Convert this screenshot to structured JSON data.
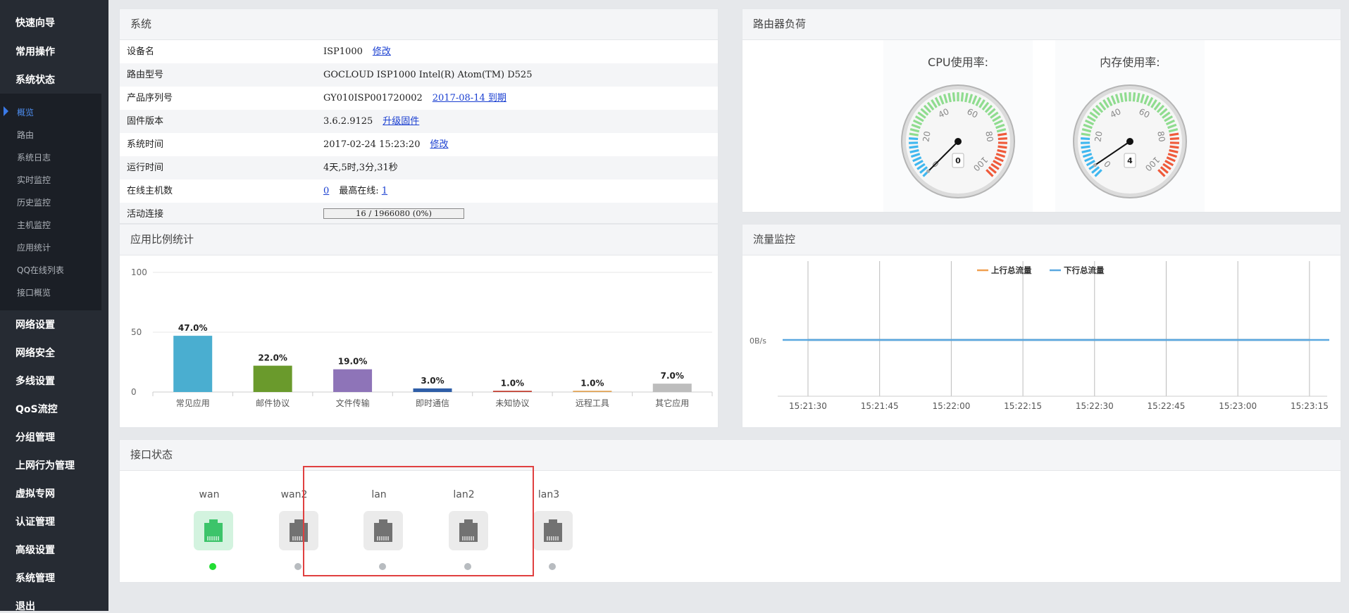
{
  "sidebar": {
    "menu": [
      "快速向导",
      "常用操作",
      "系统状态",
      "网络设置",
      "网络安全",
      "多线设置",
      "QoS流控",
      "分组管理",
      "上网行为管理",
      "虚拟专网",
      "认证管理",
      "高级设置",
      "系统管理",
      "退出"
    ],
    "submenu": [
      "概览",
      "路由",
      "系统日志",
      "实时监控",
      "历史监控",
      "主机监控",
      "应用统计",
      "QQ在线列表",
      "接口概览"
    ],
    "active_sub": "概览"
  },
  "system": {
    "title": "系统",
    "device_name_label": "设备名",
    "device_name": "ISP1000",
    "edit": "修改",
    "model_label": "路由型号",
    "model": "GOCLOUD ISP1000 Intel(R) Atom(TM) D525",
    "serial_label": "产品序列号",
    "serial": "GY010ISP001720002",
    "expiry": "2017-08-14 到期",
    "firmware_label": "固件版本",
    "firmware": "3.6.2.9125",
    "upgrade": "升级固件",
    "time_label": "系统时间",
    "time": "2017-02-24 15:23:20",
    "time_edit": "修改",
    "uptime_label": "运行时间",
    "uptime": "4天,5时,3分,31秒",
    "hosts_label": "在线主机数",
    "hosts": "0",
    "max_online_label": "最高在线:",
    "max_online": "1",
    "conn_label": "活动连接",
    "conn_text": "16 / 1966080 (0%)",
    "conn_fraction": 0.0
  },
  "router_load": {
    "title": "路由器负荷",
    "cpu_label": "CPU使用率:",
    "cpu_value": 0,
    "mem_label": "内存使用率:",
    "mem_value": 4,
    "scale_labels": [
      "0",
      "20",
      "40",
      "60",
      "80",
      "100"
    ]
  },
  "app_stats": {
    "title": "应用比例统计"
  },
  "traffic": {
    "title": "流量监控"
  },
  "interfaces": {
    "title": "接口状态",
    "items": [
      {
        "name": "wan",
        "status": "up"
      },
      {
        "name": "wan2",
        "status": "down"
      },
      {
        "name": "lan",
        "status": "down"
      },
      {
        "name": "lan2",
        "status": "down"
      },
      {
        "name": "lan3",
        "status": "down"
      }
    ]
  },
  "chart_data": [
    {
      "type": "bar",
      "categories": [
        "常见应用",
        "邮件协议",
        "文件传输",
        "即时通信",
        "未知协议",
        "远程工具",
        "其它应用"
      ],
      "values": [
        47.0,
        22.0,
        19.0,
        3.0,
        1.0,
        1.0,
        7.0
      ],
      "data_labels": [
        "47.0%",
        "22.0%",
        "19.0%",
        "3.0%",
        "1.0%",
        "1.0%",
        "7.0%"
      ],
      "colors": [
        "#4aaed0",
        "#6a9a2c",
        "#8e74b8",
        "#2f5ea7",
        "#c0392b",
        "#e0a050",
        "#bdbdbd"
      ],
      "yticks": [
        "0",
        "50",
        "100"
      ],
      "ylim": [
        0,
        100
      ]
    },
    {
      "type": "line",
      "x": [
        "15:21:30",
        "15:21:45",
        "15:22:00",
        "15:22:15",
        "15:22:30",
        "15:22:45",
        "15:23:00",
        "15:23:15"
      ],
      "series": [
        {
          "name": "上行总流量",
          "color": "#f0a050",
          "values": [
            0,
            0,
            0,
            0,
            0,
            0,
            0,
            0
          ]
        },
        {
          "name": "下行总流量",
          "color": "#5aa8e0",
          "values": [
            0,
            0,
            0,
            0,
            0,
            0,
            0,
            0
          ]
        }
      ],
      "ytick": "0B/s"
    }
  ]
}
